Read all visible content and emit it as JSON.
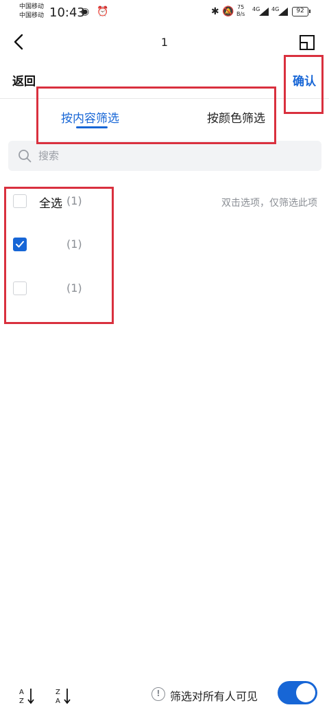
{
  "status_bar": {
    "carrier_1": "中国移动",
    "carrier_2": "中国移动",
    "time": "10:43",
    "net_speed_value": "75",
    "net_speed_unit": "B/s",
    "signal_1": "4G",
    "signal_2": "4G",
    "battery": "92"
  },
  "nav": {
    "title": "1"
  },
  "header": {
    "back_label": "返回",
    "confirm_label": "确认"
  },
  "tabs": [
    {
      "label": "按内容筛选",
      "active": true
    },
    {
      "label": "按颜色筛选",
      "active": false
    }
  ],
  "search": {
    "placeholder": "搜索",
    "value": ""
  },
  "list": {
    "hint": "双击选项，仅筛选此项",
    "items": [
      {
        "label": "全选",
        "count": "(1)",
        "checked": false
      },
      {
        "label": "",
        "count": "(1)",
        "checked": true
      },
      {
        "label": "",
        "count": "(1)",
        "checked": false
      }
    ]
  },
  "bottom": {
    "visibility_text": "筛选对所有人可见",
    "toggle_on": true
  },
  "colors": {
    "accent": "#1766d6",
    "highlight": "#d9303e"
  }
}
